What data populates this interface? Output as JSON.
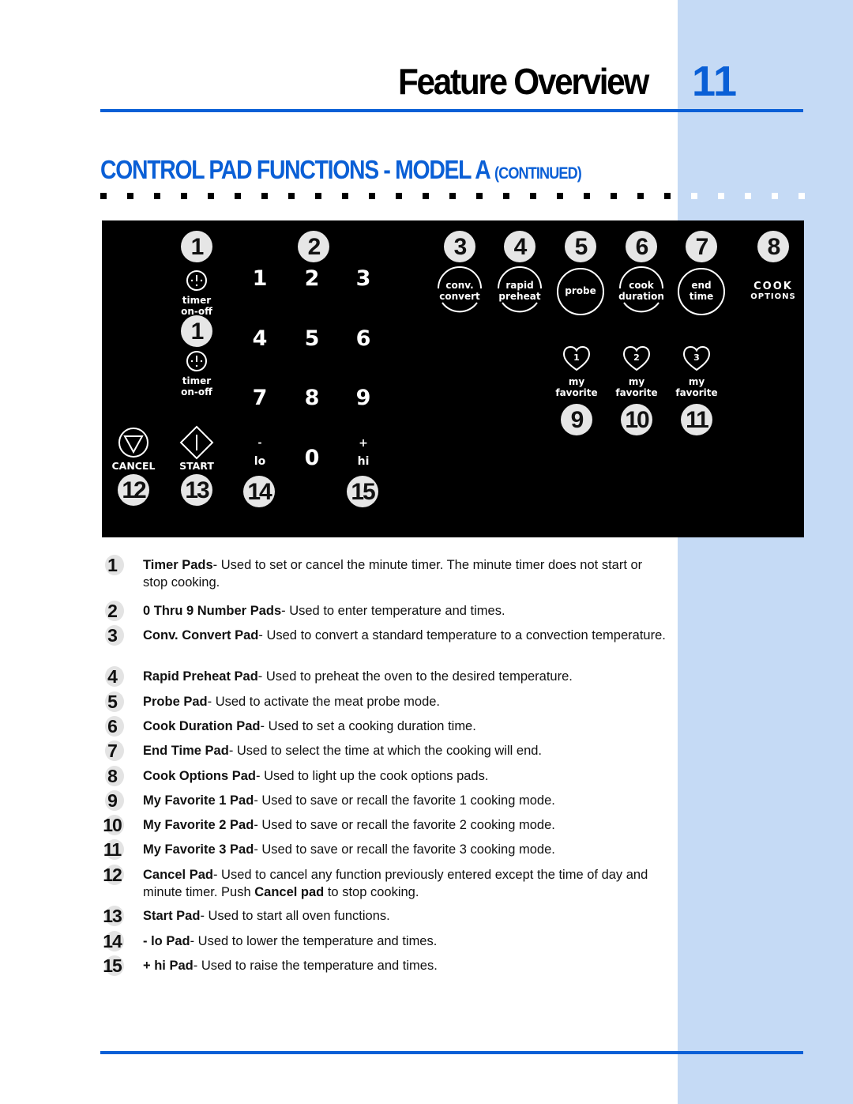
{
  "header": {
    "title": "Feature Overview",
    "page_number": "11"
  },
  "section": {
    "title": "CONTROL PAD FUNCTIONS - MODEL A",
    "subtitle": "(CONTINUED)"
  },
  "colors": {
    "accent_blue": "#0a5fd6",
    "sidebar_blue": "#c5daf5",
    "panel_black": "#000000",
    "badge_gray": "#e6e6e6"
  },
  "panel": {
    "timer_pads": [
      {
        "badge": "1",
        "icon": "timer-icon",
        "label_line1": "timer",
        "label_line2": "on-off"
      },
      {
        "badge": "1",
        "icon": "timer-icon",
        "label_line1": "timer",
        "label_line2": "on-off"
      }
    ],
    "number_badge": "2",
    "number_keys": [
      "1",
      "2",
      "3",
      "4",
      "5",
      "6",
      "7",
      "8",
      "9",
      "0"
    ],
    "cancel": {
      "label": "CANCEL",
      "badge": "12",
      "icon": "cancel-triangle-icon"
    },
    "start": {
      "label": "START",
      "badge": "13",
      "icon": "start-diamond-icon"
    },
    "lo": {
      "sign": "-",
      "label": "lo",
      "badge": "14"
    },
    "hi": {
      "sign": "+",
      "label": "hi",
      "badge": "15"
    },
    "function_pads": [
      {
        "badge": "3",
        "line1": "conv.",
        "line2": "convert",
        "style": "arc"
      },
      {
        "badge": "4",
        "line1": "rapid",
        "line2": "preheat",
        "style": "arc"
      },
      {
        "badge": "5",
        "line1": "probe",
        "line2": "",
        "style": "circle"
      },
      {
        "badge": "6",
        "line1": "cook",
        "line2": "duration",
        "style": "arc"
      },
      {
        "badge": "7",
        "line1": "end",
        "line2": "time",
        "style": "circle"
      }
    ],
    "cook_options": {
      "badge": "8",
      "line1": "COOK",
      "line2": "OPTIONS"
    },
    "favorites": [
      {
        "heart": "1",
        "line1": "my",
        "line2": "favorite",
        "badge": "9"
      },
      {
        "heart": "2",
        "line1": "my",
        "line2": "favorite",
        "badge": "10"
      },
      {
        "heart": "3",
        "line1": "my",
        "line2": "favorite",
        "badge": "11"
      }
    ]
  },
  "descriptions": [
    {
      "num": "1",
      "name": "Timer Pads",
      "text": "- Used to set or cancel the minute timer. The minute timer does not start or stop cooking."
    },
    {
      "num": "2",
      "name": "0 Thru 9 Number Pads",
      "text": "- Used to enter temperature and times."
    },
    {
      "num": "3",
      "name": "Conv. Convert Pad",
      "text": "- Used to convert a standard temperature to a convection temperature."
    },
    {
      "num": "4",
      "name": "Rapid Preheat Pad",
      "text": "- Used to preheat the oven to the desired temperature."
    },
    {
      "num": "5",
      "name": "Probe Pad",
      "text": "- Used to activate the meat probe mode."
    },
    {
      "num": "6",
      "name": "Cook Duration Pad",
      "text": "- Used to set a cooking duration time."
    },
    {
      "num": "7",
      "name": "End Time Pad",
      "text": "- Used to select the time at which the cooking will end."
    },
    {
      "num": "8",
      "name": "Cook Options Pad",
      "text": "- Used to light up the cook options pads."
    },
    {
      "num": "9",
      "name": "My Favorite 1 Pad",
      "text": "- Used to save or recall the favorite 1 cooking mode."
    },
    {
      "num": "10",
      "name": "My Favorite 2 Pad",
      "text": "- Used to save or recall the favorite 2 cooking mode."
    },
    {
      "num": "11",
      "name": "My Favorite 3 Pad",
      "text": "- Used to save or recall the favorite 3 cooking mode."
    },
    {
      "num": "12",
      "name": "Cancel Pad",
      "text": "- Used to cancel any function previously entered except the time of day and minute timer. Push ",
      "bold2": "Cancel pad",
      "text2": " to stop cooking."
    },
    {
      "num": "13",
      "name": "Start Pad",
      "text": "- Used to start all oven functions."
    },
    {
      "num": "14",
      "name": "- lo Pad",
      "text": "- Used to lower the temperature and times."
    },
    {
      "num": "15",
      "name": "+ hi Pad",
      "text": "- Used to raise the temperature and times."
    }
  ]
}
